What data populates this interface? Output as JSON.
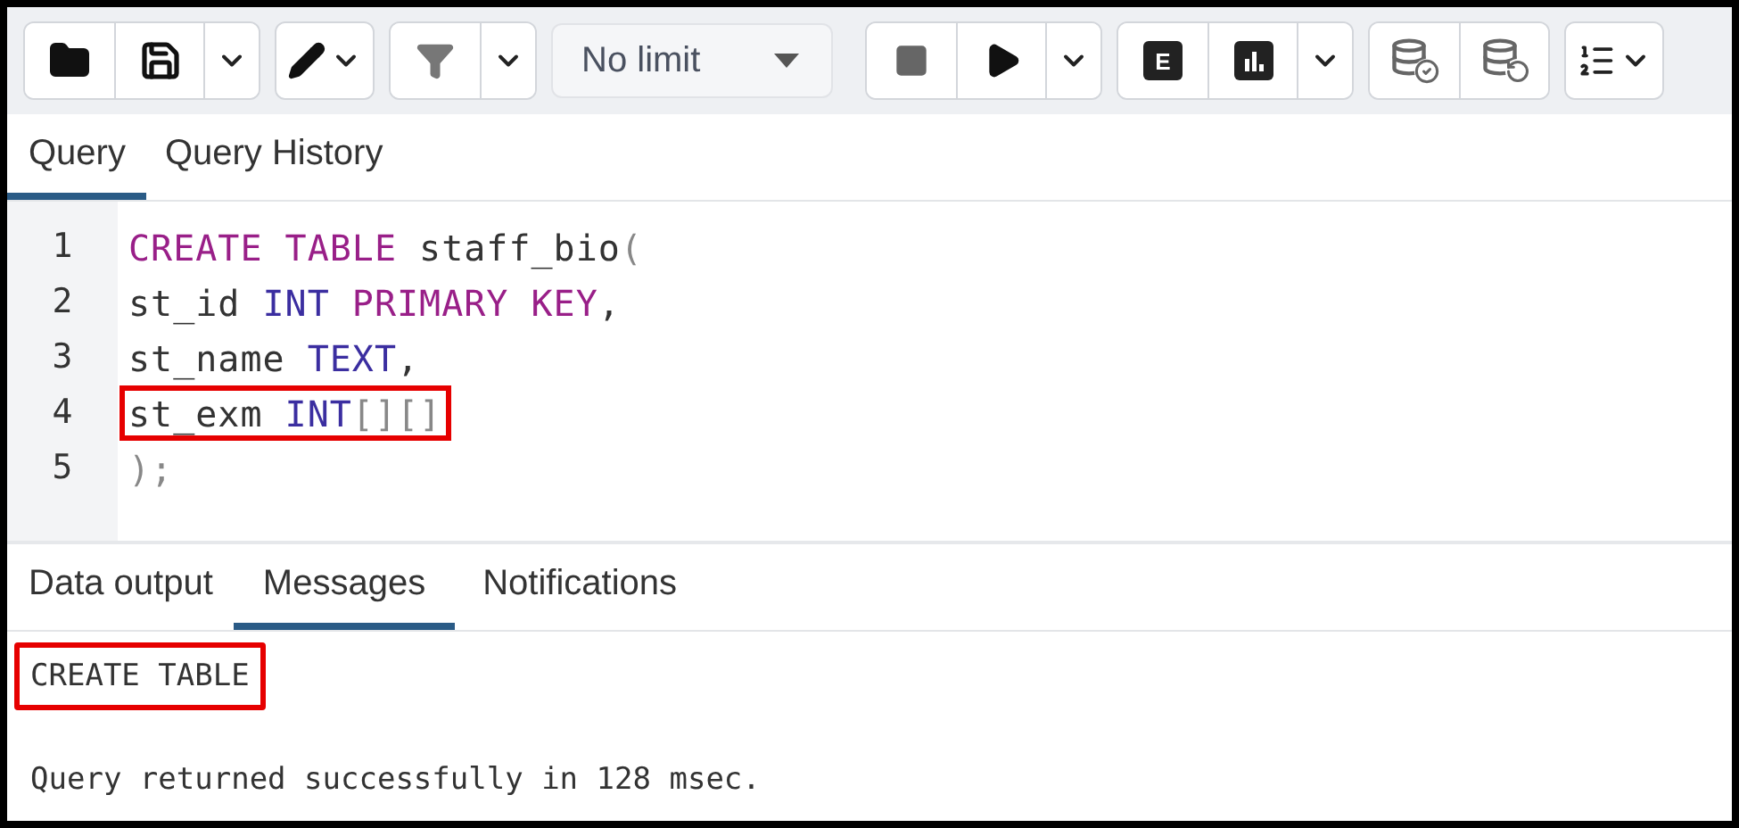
{
  "toolbar": {
    "groups": [
      {
        "buttons": [
          {
            "kind": "folder"
          },
          {
            "kind": "save"
          },
          {
            "kind": "caret"
          }
        ]
      },
      {
        "buttons": [
          {
            "kind": "pencil-caret"
          }
        ]
      },
      {
        "buttons": [
          {
            "kind": "filter"
          },
          {
            "kind": "caret"
          }
        ]
      },
      {
        "kind": "select",
        "value": "No limit"
      },
      {
        "buttons": [
          {
            "kind": "stop"
          },
          {
            "kind": "play"
          },
          {
            "kind": "caret"
          }
        ]
      },
      {
        "buttons": [
          {
            "kind": "letter",
            "label": "E"
          },
          {
            "kind": "chart"
          },
          {
            "kind": "caret"
          }
        ]
      },
      {
        "buttons": [
          {
            "kind": "db-check"
          },
          {
            "kind": "db-undo"
          }
        ]
      },
      {
        "buttons": [
          {
            "kind": "list-caret"
          }
        ]
      }
    ]
  },
  "editor_tabs": [
    {
      "label": "Query",
      "selected": true
    },
    {
      "label": "Query History",
      "selected": false
    }
  ],
  "code": [
    {
      "number": "1",
      "highlighted": false,
      "tokens": [
        {
          "kind": "keyword",
          "text": "CREATE TABLE"
        },
        {
          "kind": "plain",
          "text": " staff_bio"
        },
        {
          "kind": "punct",
          "text": "("
        }
      ]
    },
    {
      "number": "2",
      "highlighted": false,
      "tokens": [
        {
          "kind": "plain",
          "text": "st_id "
        },
        {
          "kind": "type",
          "text": "INT"
        },
        {
          "kind": "keyword",
          "text": " PRIMARY KEY"
        },
        {
          "kind": "plain",
          "text": ","
        }
      ]
    },
    {
      "number": "3",
      "highlighted": false,
      "tokens": [
        {
          "kind": "plain",
          "text": "st_name "
        },
        {
          "kind": "type",
          "text": "TEXT"
        },
        {
          "kind": "plain",
          "text": ","
        }
      ]
    },
    {
      "number": "4",
      "highlighted": true,
      "tokens": [
        {
          "kind": "plain",
          "text": "st_exm "
        },
        {
          "kind": "type",
          "text": "INT"
        },
        {
          "kind": "punct",
          "text": "[][]"
        }
      ]
    },
    {
      "number": "5",
      "highlighted": false,
      "tokens": [
        {
          "kind": "punct",
          "text": ");"
        }
      ]
    }
  ],
  "output_tabs": [
    {
      "label": "Data output",
      "selected": false
    },
    {
      "label": "Messages",
      "selected": true
    },
    {
      "label": "Notifications",
      "selected": false
    }
  ],
  "messages": [
    {
      "text": "CREATE TABLE",
      "highlighted": true
    },
    {
      "text": "Query returned successfully in 128 msec.",
      "highlighted": false
    }
  ]
}
